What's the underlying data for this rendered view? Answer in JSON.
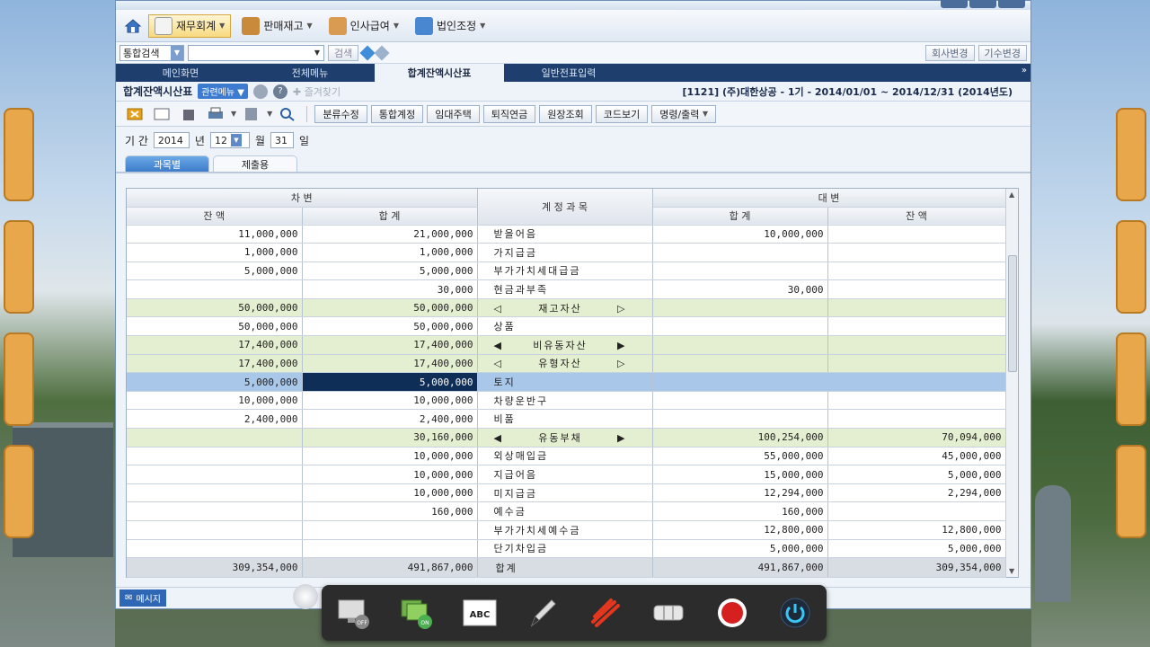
{
  "menu": {
    "items": [
      {
        "label": "재무회계",
        "active": true
      },
      {
        "label": "판매재고",
        "active": false
      },
      {
        "label": "인사급여",
        "active": false
      },
      {
        "label": "법인조정",
        "active": false
      }
    ]
  },
  "search": {
    "combo_label": "통합검색",
    "search_button": "검색",
    "company_change": "회사변경",
    "period_change": "기수변경"
  },
  "tabs": [
    {
      "label": "메인화면"
    },
    {
      "label": "전체메뉴"
    },
    {
      "label": "합계잔액시산표"
    },
    {
      "label": "일반전표입력"
    }
  ],
  "header": {
    "title": "합계잔액시산표",
    "related_menu": "관련메뉴",
    "bookmark": "즐겨찾기",
    "company_info": "[1121] (주)대한상공 - 1기 - 2014/01/01 ~ 2014/12/31 (2014년도)"
  },
  "toolbar": {
    "buttons": [
      "분류수정",
      "통합계정",
      "임대주택",
      "퇴직연금",
      "원장조회",
      "코드보기",
      "명령/출력"
    ]
  },
  "period": {
    "label": "기 간",
    "year": "2014",
    "year_unit": "년",
    "month": "12",
    "month_unit": "월",
    "day": "31",
    "day_unit": "일"
  },
  "subtabs": [
    {
      "label": "과목별"
    },
    {
      "label": "제출용"
    }
  ],
  "table": {
    "debit_header": "차          변",
    "credit_header": "대          변",
    "account_header": "계   정   과   목",
    "debit_balance": "잔          액",
    "debit_total": "합          계",
    "credit_total": "합          계",
    "credit_balance": "잔          액",
    "rows": [
      {
        "db": "11,000,000",
        "dt": "21,000,000",
        "acct": "받을어음",
        "ct": "10,000,000",
        "cb": "",
        "style": ""
      },
      {
        "db": "1,000,000",
        "dt": "1,000,000",
        "acct": "가지급금",
        "ct": "",
        "cb": "",
        "style": ""
      },
      {
        "db": "5,000,000",
        "dt": "5,000,000",
        "acct": "부가가치세대급금",
        "ct": "",
        "cb": "",
        "style": ""
      },
      {
        "db": "",
        "dt": "30,000",
        "acct": "현금과부족",
        "ct": "30,000",
        "cb": "",
        "style": ""
      },
      {
        "db": "50,000,000",
        "dt": "50,000,000",
        "acct": "◁재고자산▷",
        "ct": "",
        "cb": "",
        "style": "hl"
      },
      {
        "db": "50,000,000",
        "dt": "50,000,000",
        "acct": "상품",
        "ct": "",
        "cb": "",
        "style": ""
      },
      {
        "db": "17,400,000",
        "dt": "17,400,000",
        "acct": "◀비유동자산▶",
        "ct": "",
        "cb": "",
        "style": "hl"
      },
      {
        "db": "17,400,000",
        "dt": "17,400,000",
        "acct": "◁유형자산▷",
        "ct": "",
        "cb": "",
        "style": "hl"
      },
      {
        "db": "5,000,000",
        "dt": "5,000,000",
        "acct": "토지",
        "ct": "",
        "cb": "",
        "style": "sel"
      },
      {
        "db": "10,000,000",
        "dt": "10,000,000",
        "acct": "차량운반구",
        "ct": "",
        "cb": "",
        "style": ""
      },
      {
        "db": "2,400,000",
        "dt": "2,400,000",
        "acct": "비품",
        "ct": "",
        "cb": "",
        "style": ""
      },
      {
        "db": "",
        "dt": "30,160,000",
        "acct": "◀유동부채▶",
        "ct": "100,254,000",
        "cb": "70,094,000",
        "style": "hl"
      },
      {
        "db": "",
        "dt": "10,000,000",
        "acct": "외상매입금",
        "ct": "55,000,000",
        "cb": "45,000,000",
        "style": ""
      },
      {
        "db": "",
        "dt": "10,000,000",
        "acct": "지급어음",
        "ct": "15,000,000",
        "cb": "5,000,000",
        "style": ""
      },
      {
        "db": "",
        "dt": "10,000,000",
        "acct": "미지급금",
        "ct": "12,294,000",
        "cb": "2,294,000",
        "style": ""
      },
      {
        "db": "",
        "dt": "160,000",
        "acct": "예수금",
        "ct": "160,000",
        "cb": "",
        "style": ""
      },
      {
        "db": "",
        "dt": "",
        "acct": "부가가치세예수금",
        "ct": "12,800,000",
        "cb": "12,800,000",
        "style": ""
      },
      {
        "db": "",
        "dt": "",
        "acct": "단기차입금",
        "ct": "5,000,000",
        "cb": "5,000,000",
        "style": ""
      }
    ],
    "total": {
      "db": "309,354,000",
      "dt": "491,867,000",
      "acct": "합계",
      "ct": "491,867,000",
      "cb": "309,354,000"
    }
  },
  "status": {
    "message": "메시지"
  },
  "capture_toolbar": {
    "off_badge": "OFF",
    "on_badge": "ON",
    "abc_label": "ABC"
  },
  "colors": {
    "accent": "#1e3e6d",
    "highlight_row": "#e4eed0",
    "selected_row": "#a9c7e8",
    "focus_cell": "#0f2e57"
  }
}
